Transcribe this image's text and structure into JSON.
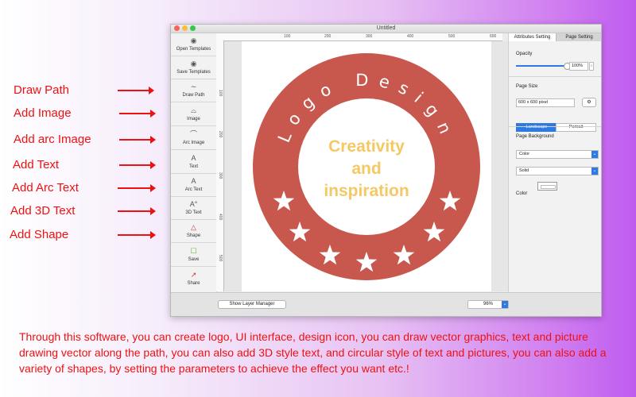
{
  "callouts": [
    "Draw Path",
    "Add Image",
    "Add arc Image",
    "Add Text",
    "Add  Arc Text",
    "Add  3D Text",
    "Add  Shape"
  ],
  "window": {
    "title": "Untitled"
  },
  "sidebar": {
    "tools": [
      {
        "label": "Open Templates",
        "icon": "open-templates-icon"
      },
      {
        "label": "Save Templates",
        "icon": "save-templates-icon"
      },
      {
        "label": "Draw Path",
        "icon": "path-icon"
      },
      {
        "label": "Image",
        "icon": "image-icon"
      },
      {
        "label": "Arc Image",
        "icon": "arc-image-icon"
      },
      {
        "label": "Text",
        "icon": "text-icon"
      },
      {
        "label": "Arc Text",
        "icon": "arc-text-icon"
      },
      {
        "label": "3D Text",
        "icon": "3d-text-icon"
      },
      {
        "label": "Shape",
        "icon": "shape-icon"
      },
      {
        "label": "Save",
        "icon": "save-icon"
      },
      {
        "label": "Share",
        "icon": "share-icon"
      }
    ]
  },
  "ruler": {
    "horizontal": [
      "100",
      "200",
      "300",
      "400",
      "500",
      "600"
    ],
    "vertical": [
      "100",
      "200",
      "300",
      "400",
      "500",
      "600"
    ]
  },
  "logo": {
    "ring_text": "Logo Design",
    "line1": "Creativity",
    "line2": "and",
    "line3": "inspiration",
    "ring_color": "#c8584d",
    "text_color": "#f5c864",
    "star_count": 7
  },
  "panel": {
    "tabs": [
      "Attributes Setting",
      "Page Setting"
    ],
    "opacity_label": "Opacity",
    "opacity_value": "100%",
    "page_size_label": "Page Size",
    "page_size_value": "600 x 600 pixel",
    "orientation": [
      "Landscape",
      "Portrait"
    ],
    "page_background_label": "Page Background",
    "background_type": "Color",
    "fill_type": "Solid",
    "color_label": "Color"
  },
  "bottom": {
    "show_layer_manager": "Show Layer Manager",
    "zoom": "96%"
  },
  "description": "Through this software, you can create logo, UI interface, design icon, you can draw vector graphics, text and picture drawing vector along the path, you can also add 3D style text, and circular style of text and pictures, you can also add a variety of shapes, by setting the parameters to achieve the effect you want etc.!",
  "colors": {
    "accent": "#2e7ae0",
    "callout": "#ee1111"
  }
}
